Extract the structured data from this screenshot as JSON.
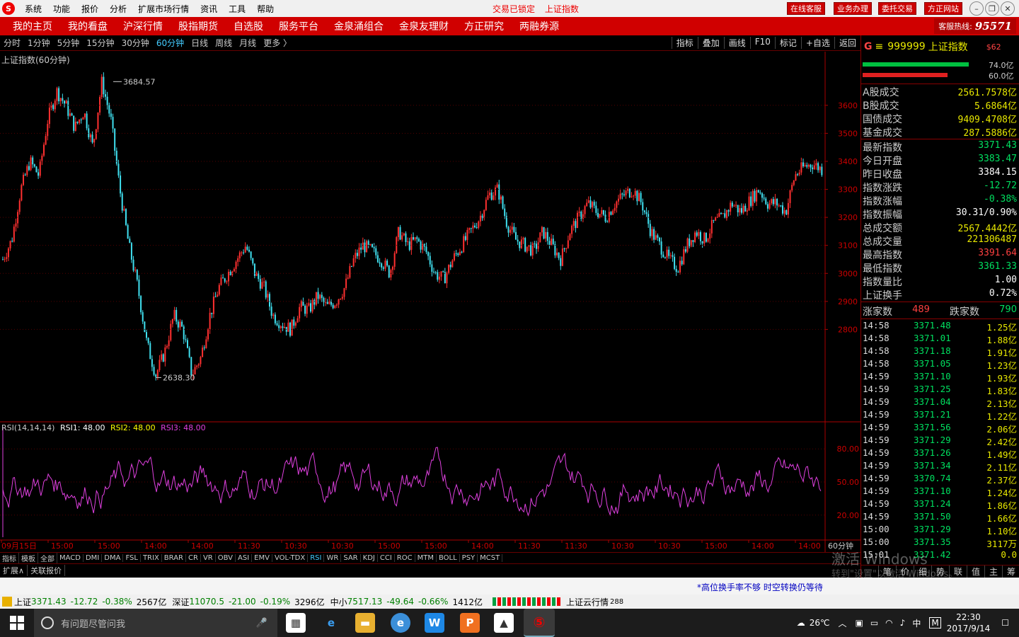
{
  "menu": {
    "items": [
      "系统",
      "功能",
      "报价",
      "分析",
      "扩展市场行情",
      "资讯",
      "工具",
      "帮助"
    ],
    "status_left": "交易已锁定",
    "status_right": "上证指数",
    "buttons": [
      "在线客服",
      "业务办理",
      "委托交易",
      "方正网站"
    ]
  },
  "nav": {
    "items": [
      "我的主页",
      "我的看盘",
      "沪深行情",
      "股指期货",
      "自选股",
      "服务平台",
      "金泉涌组合",
      "金泉友理财",
      "方正研究",
      "两融券源"
    ],
    "hotline_label": "客服热线:",
    "hotline_number": "95571"
  },
  "periods": {
    "items": [
      "分时",
      "1分钟",
      "5分钟",
      "15分钟",
      "30分钟",
      "60分钟",
      "日线",
      "周线",
      "月线",
      "更多 〉"
    ],
    "active": "60分钟",
    "tools": [
      "指标",
      "叠加",
      "画线",
      "F10",
      "标记",
      "+自选",
      "返回"
    ]
  },
  "chart": {
    "title": "上证指数(60分钟)",
    "high_label": "3684.57",
    "low_label": "2638.30",
    "price_axis": [
      "3600",
      "3500",
      "3400",
      "3300",
      "3200",
      "3100",
      "3000",
      "2900",
      "2800"
    ],
    "rsi_title": "RSI(14,14,14)",
    "rsi1": "RSI1: 48.00",
    "rsi2": "RSI2: 48.00",
    "rsi3": "RSI3: 48.00",
    "rsi_axis": [
      "80.00",
      "50.00",
      "20.00"
    ],
    "time_axis": [
      "09月15日",
      "15:00",
      "15:00",
      "14:00",
      "14:00",
      "11:30",
      "10:30",
      "10:30",
      "15:00",
      "15:00",
      "14:00",
      "11:30",
      "11:30",
      "10:30",
      "10:30",
      "15:00",
      "14:00",
      "14:00"
    ],
    "period_label": "60分钟"
  },
  "chart_data": {
    "type": "line",
    "title": "上证指数(60分钟)",
    "high": 3684.57,
    "low": 2638.3,
    "ylim": [
      2638.3,
      3684.57
    ],
    "series": [
      {
        "name": "上证指数",
        "values": [
          3050,
          3120,
          3300,
          3400,
          3350,
          3550,
          3650,
          3600,
          3520,
          3580,
          3450,
          3684.57,
          3550,
          3300,
          3100,
          2950,
          2750,
          2638.3,
          2720,
          2850,
          2800,
          2638.3,
          2700,
          2850,
          2950,
          3000,
          3050,
          3100,
          3000,
          2950,
          2850,
          2820,
          2800,
          2880,
          2870,
          2920,
          2880,
          2900,
          2950,
          3050,
          3100,
          3080,
          3050,
          3000,
          3150,
          3100,
          3120,
          3080,
          3000,
          2980,
          3050,
          3100,
          3150,
          3200,
          3280,
          3300,
          3180,
          3120,
          3100,
          3080,
          3150,
          3100,
          3050,
          3150,
          3200,
          3250,
          3220,
          3200,
          3250,
          3280,
          3300,
          3250,
          3150,
          3100,
          3050,
          3020,
          3100,
          3150,
          3120,
          3180,
          3200,
          3250,
          3220,
          3260,
          3300,
          3250,
          3250,
          3220,
          3350,
          3380,
          3391.64,
          3371.43
        ]
      }
    ],
    "rsi": {
      "name": "RSI",
      "ylim": [
        0,
        100
      ],
      "levels": [
        20,
        50,
        80
      ]
    }
  },
  "quote": {
    "code": "999999",
    "name": "上证指数",
    "badge": "$62",
    "bar_up": "74.0亿",
    "bar_down": "60.0亿",
    "rows1": [
      {
        "label": "A股成交",
        "value": "2561.7578亿"
      },
      {
        "label": "B股成交",
        "value": "5.6864亿"
      },
      {
        "label": "国债成交",
        "value": "9409.4708亿"
      },
      {
        "label": "基金成交",
        "value": "287.5886亿"
      }
    ],
    "rows2": [
      {
        "label": "最新指数",
        "value": "3371.43",
        "color": "#00e060"
      },
      {
        "label": "今日开盘",
        "value": "3383.47",
        "color": "#00e060"
      },
      {
        "label": "昨日收盘",
        "value": "3384.15",
        "color": "#ffffff"
      },
      {
        "label": "指数涨跌",
        "value": "-12.72",
        "color": "#00e060"
      },
      {
        "label": "指数涨幅",
        "value": "-0.38%",
        "color": "#00e060"
      },
      {
        "label": "指数振幅",
        "value": "30.31/0.90%",
        "color": "#ffffff"
      },
      {
        "label": "总成交额",
        "value": "2567.4442亿",
        "color": "#e8e800"
      },
      {
        "label": "总成交量",
        "value": "221306487",
        "color": "#e8e800"
      },
      {
        "label": "最高指数",
        "value": "3391.64",
        "color": "#ff4040"
      },
      {
        "label": "最低指数",
        "value": "3361.33",
        "color": "#00e060"
      },
      {
        "label": "指数量比",
        "value": "1.00",
        "color": "#ffffff"
      },
      {
        "label": "上证换手",
        "value": "0.72%",
        "color": "#ffffff"
      }
    ],
    "up_label": "涨家数",
    "up_count": "489",
    "down_label": "跌家数",
    "down_count": "790",
    "ticks": [
      {
        "t": "14:58",
        "p": "3371.48",
        "v": "1.25亿"
      },
      {
        "t": "14:58",
        "p": "3371.01",
        "v": "1.88亿"
      },
      {
        "t": "14:58",
        "p": "3371.18",
        "v": "1.91亿"
      },
      {
        "t": "14:58",
        "p": "3371.05",
        "v": "1.23亿"
      },
      {
        "t": "14:59",
        "p": "3371.10",
        "v": "1.93亿"
      },
      {
        "t": "14:59",
        "p": "3371.25",
        "v": "1.83亿"
      },
      {
        "t": "14:59",
        "p": "3371.04",
        "v": "2.13亿"
      },
      {
        "t": "14:59",
        "p": "3371.21",
        "v": "1.22亿"
      },
      {
        "t": "14:59",
        "p": "3371.56",
        "v": "2.06亿"
      },
      {
        "t": "14:59",
        "p": "3371.29",
        "v": "2.42亿"
      },
      {
        "t": "14:59",
        "p": "3371.26",
        "v": "1.49亿"
      },
      {
        "t": "14:59",
        "p": "3371.34",
        "v": "2.11亿"
      },
      {
        "t": "14:59",
        "p": "3370.74",
        "v": "2.37亿"
      },
      {
        "t": "14:59",
        "p": "3371.10",
        "v": "1.24亿"
      },
      {
        "t": "14:59",
        "p": "3371.24",
        "v": "1.86亿"
      },
      {
        "t": "14:59",
        "p": "3371.50",
        "v": "1.66亿"
      },
      {
        "t": "15:00",
        "p": "3371.29",
        "v": "1.10亿"
      },
      {
        "t": "15:00",
        "p": "3371.35",
        "v": "3117万"
      },
      {
        "t": "15:01",
        "p": "3371.42",
        "v": "0.0"
      }
    ],
    "tabs": [
      "笔",
      "价",
      "细",
      "势",
      "联",
      "值",
      "主",
      "筹"
    ]
  },
  "indicators": {
    "items": [
      "指标",
      "模板",
      "全部",
      "MACD",
      "DMI",
      "DMA",
      "FSL",
      "TRIX",
      "BRAR",
      "CR",
      "VR",
      "OBV",
      "ASI",
      "EMV",
      "VOL-TDX",
      "RSI",
      "WR",
      "SAR",
      "KDJ",
      "CCI",
      "ROC",
      "MTM",
      "BOLL",
      "PSY",
      "MCST"
    ],
    "active": "RSI",
    "ext": [
      "扩展∧",
      "关联报价"
    ]
  },
  "notice": "*高位换手率不够 时空转换仍等待",
  "bottom": {
    "sh_label": "上证",
    "sh_value": "3371.43",
    "sh_change": "-12.72",
    "sh_pct": "-0.38%",
    "sh_amount": "2567亿",
    "sz_label": "深证",
    "sz_value": "11070.5",
    "sz_change": "-21.00",
    "sz_pct": "-0.19%",
    "sz_amount": "3296亿",
    "zx_label": "中小",
    "zx_value": "7517.13",
    "zx_change": "-49.64",
    "zx_pct": "-0.66%",
    "zx_amount": "1412亿",
    "cloud": "上证云行情",
    "cloud_num": "288"
  },
  "taskbar": {
    "search_placeholder": "有问题尽管问我",
    "weather": "26℃",
    "ime": "中",
    "time": "22:30",
    "date": "2017/9/14"
  },
  "watermark": {
    "line1": "激活 Windows",
    "line2": "转到\"设置\"以激活 Windows。"
  }
}
